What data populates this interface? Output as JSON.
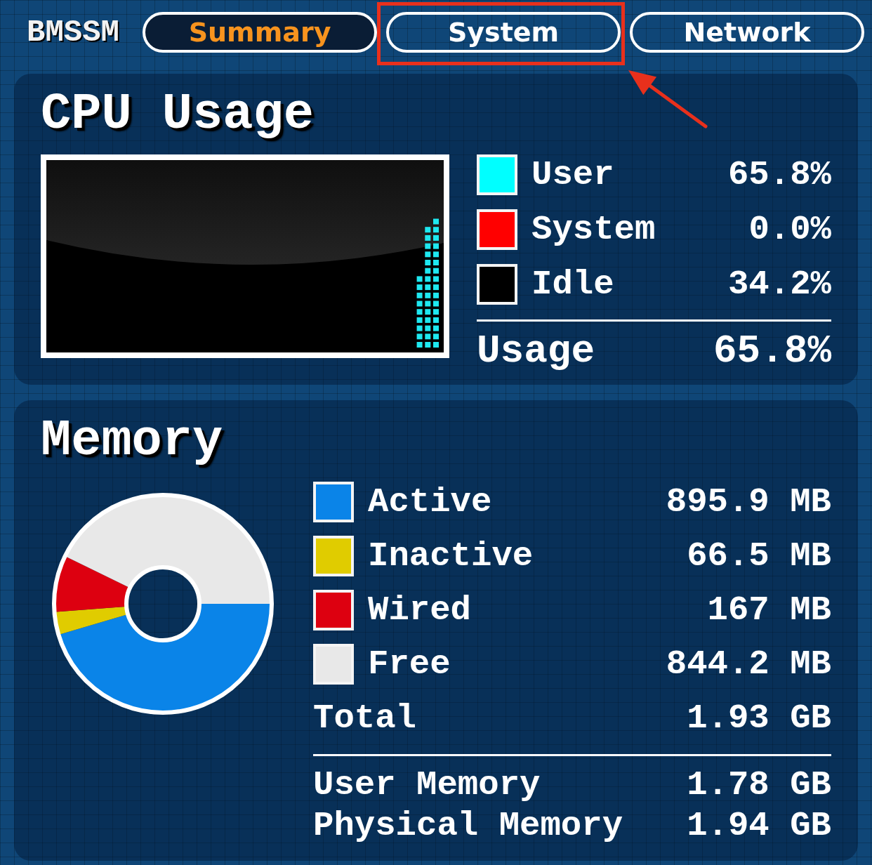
{
  "app": {
    "title": "BMSSM"
  },
  "tabs": [
    {
      "label": "Summary",
      "selected": true,
      "highlighted": false
    },
    {
      "label": "System",
      "selected": false,
      "highlighted": true
    },
    {
      "label": "Network",
      "selected": false,
      "highlighted": false
    }
  ],
  "cpu": {
    "title": "CPU Usage",
    "legend": [
      {
        "label": "User",
        "value": "65.8%",
        "color": "#00ffff"
      },
      {
        "label": "System",
        "value": "0.0%",
        "color": "#ff0000"
      },
      {
        "label": "Idle",
        "value": "34.2%",
        "color": "#000000"
      }
    ],
    "total": {
      "label": "Usage",
      "value": "65.8%"
    }
  },
  "memory": {
    "title": "Memory",
    "chart_data": {
      "type": "donut",
      "values": [
        45.4,
        3.4,
        8.4,
        42.8
      ]
    },
    "legend": [
      {
        "label": "Active",
        "value": "895.9 MB",
        "color": "#0a84e8"
      },
      {
        "label": "Inactive",
        "value": "66.5 MB",
        "color": "#e0cc00"
      },
      {
        "label": "Wired",
        "value": "167 MB",
        "color": "#dd0010"
      },
      {
        "label": "Free",
        "value": "844.2 MB",
        "color": "#e8e8e8"
      }
    ],
    "total": {
      "label": "Total",
      "value": "1.93 GB"
    },
    "details": [
      {
        "label": "User Memory",
        "value": "1.78 GB"
      },
      {
        "label": "Physical Memory",
        "value": "1.94 GB"
      }
    ]
  }
}
